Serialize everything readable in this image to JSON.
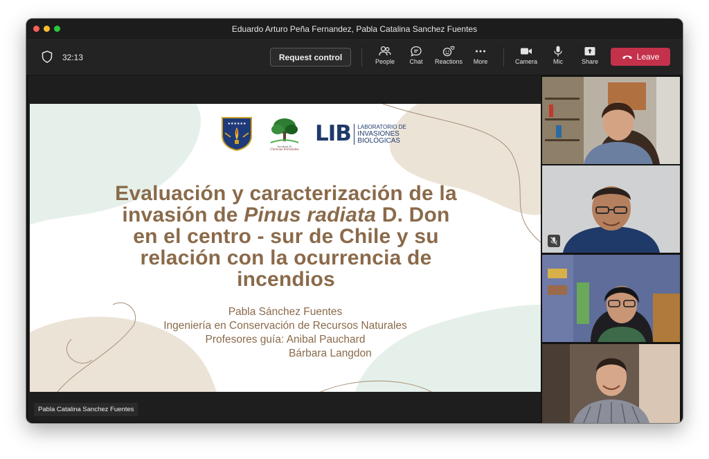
{
  "window": {
    "title": "Eduardo Arturo Peña Fernandez, Pabla Catalina Sanchez Fuentes"
  },
  "toolbar": {
    "timer": "32:13",
    "request_control": "Request control",
    "people": "People",
    "chat": "Chat",
    "reactions": "Reactions",
    "more": "More",
    "camera": "Camera",
    "mic": "Mic",
    "share": "Share",
    "leave": "Leave"
  },
  "colors": {
    "leave_red": "#c4314b",
    "slide_text": "#8a6a4a",
    "slide_blob_beige": "#ece3d7",
    "slide_blob_mint": "#e6f0ea"
  },
  "slide": {
    "logo_lib_big": "LIB",
    "logo_lib_lines": [
      "LABORATORIO DE",
      "INVASIONES",
      "BIOLÓGICAS"
    ],
    "title_line1": "Evaluación y caracterización de la",
    "title_line2_pre": "invasión de ",
    "title_line2_species": "Pinus radiata",
    "title_line2_post": " D. Don",
    "title_line3": "en el centro - sur de Chile y su",
    "title_line4": "relación con la ocurrencia de",
    "title_line5": "incendios",
    "author": "Pabla Sánchez Fuentes",
    "program": "Ingeniería en Conservación de Recursos Naturales",
    "advisors_label": "Profesores guía: Anibal Pauchard",
    "advisor2": "Bárbara Langdon"
  },
  "presenter_tag": "Pabla Catalina Sanchez Fuentes"
}
